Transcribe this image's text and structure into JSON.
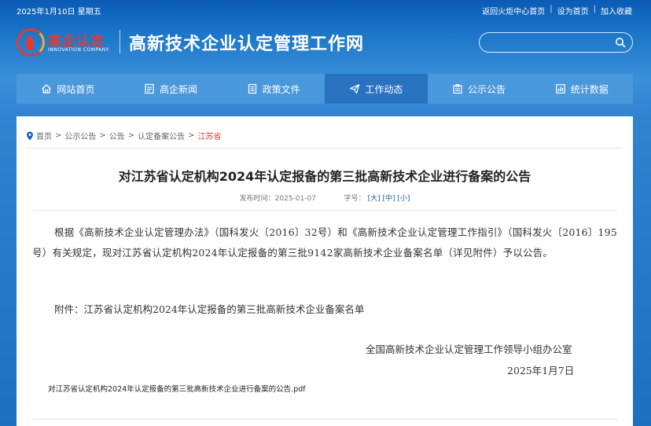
{
  "topbar": {
    "date": "2025年1月10日 星期五",
    "links": [
      "返回火炬中心首页",
      "设为首页",
      "加入收藏"
    ]
  },
  "header": {
    "logo_text": "高企认定",
    "logo_sub": "INNOVATION COMPANY",
    "site_title": "高新技术企业认定管理工作网",
    "search": {
      "placeholder": "",
      "value": ""
    }
  },
  "nav": {
    "items": [
      {
        "label": "网站首页",
        "icon": "home-icon"
      },
      {
        "label": "高企新闻",
        "icon": "news-icon"
      },
      {
        "label": "政策文件",
        "icon": "document-icon"
      },
      {
        "label": "工作动态",
        "icon": "send-icon"
      },
      {
        "label": "公示公告",
        "icon": "announcement-icon"
      },
      {
        "label": "统计数据",
        "icon": "chart-icon"
      }
    ],
    "active_index": 3
  },
  "breadcrumb": [
    "首页",
    "公示公告",
    "公告",
    "认定备案公告",
    "江苏省"
  ],
  "article": {
    "title": "对江苏省认定机构2024年认定报备的第三批高新技术企业进行备案的公告",
    "meta": {
      "published_label": "发布时间：",
      "published_date": "2025-01-07",
      "size_label": "字号：",
      "size_large": "[大]",
      "size_medium": "[中]",
      "size_small": "[小]"
    },
    "paragraph": "根据《高新技术企业认定管理办法》（国科发火〔2016〕32号）和《高新技术企业认定管理工作指引》（国科发火〔2016〕195号）有关规定，现对江苏省认定机构2024年认定报备的第三批9142家高新技术企业备案名单（详见附件）予以公告。",
    "attachment_line": "附件：江苏省认定机构2024年认定报备的第三批高新技术企业备案名单",
    "sign_org": "全国高新技术企业认定管理工作领导小组办公室",
    "sign_date": "2025年1月7日",
    "pdf_link": "对江苏省认定机构2024年认定报备的第三批高新技术企业进行备案的公告.pdf"
  },
  "colors": {
    "nav_bg": "#4a98dc",
    "nav_active": "#2872c0",
    "accent_red": "#e23b2e",
    "link_blue": "#1a5fb4"
  }
}
